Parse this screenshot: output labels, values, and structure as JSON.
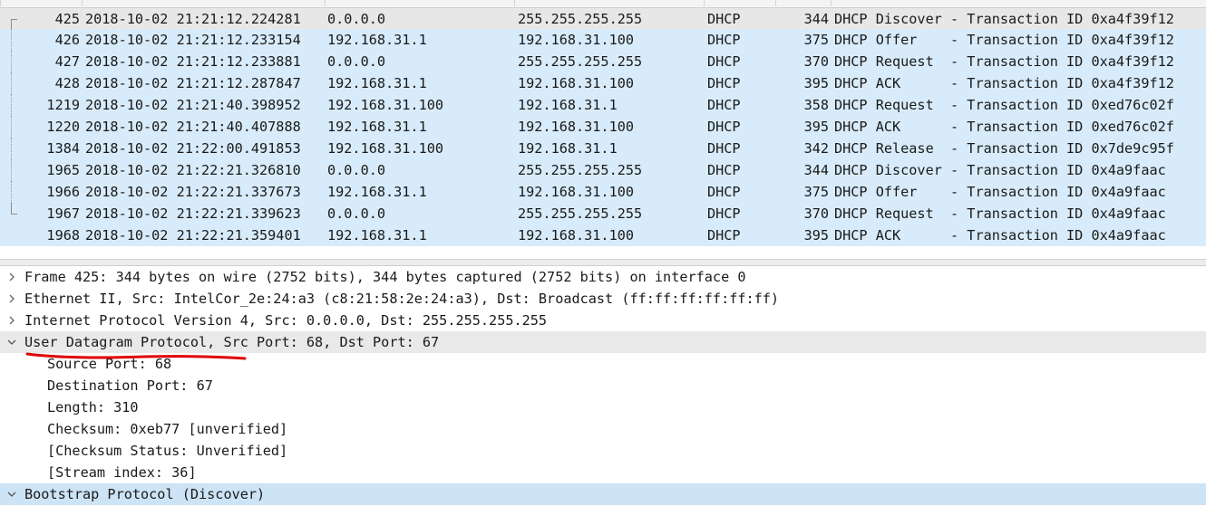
{
  "packet_list": {
    "rows": [
      {
        "no": "425",
        "time": "2018-10-02 21:21:12.224281",
        "src": "0.0.0.0",
        "dst": "255.255.255.255",
        "proto": "DHCP",
        "len": "344",
        "info": "DHCP Discover - Transaction ID 0xa4f39f12"
      },
      {
        "no": "426",
        "time": "2018-10-02 21:21:12.233154",
        "src": "192.168.31.1",
        "dst": "192.168.31.100",
        "proto": "DHCP",
        "len": "375",
        "info": "DHCP Offer    - Transaction ID 0xa4f39f12"
      },
      {
        "no": "427",
        "time": "2018-10-02 21:21:12.233881",
        "src": "0.0.0.0",
        "dst": "255.255.255.255",
        "proto": "DHCP",
        "len": "370",
        "info": "DHCP Request  - Transaction ID 0xa4f39f12"
      },
      {
        "no": "428",
        "time": "2018-10-02 21:21:12.287847",
        "src": "192.168.31.1",
        "dst": "192.168.31.100",
        "proto": "DHCP",
        "len": "395",
        "info": "DHCP ACK      - Transaction ID 0xa4f39f12"
      },
      {
        "no": "1219",
        "time": "2018-10-02 21:21:40.398952",
        "src": "192.168.31.100",
        "dst": "192.168.31.1",
        "proto": "DHCP",
        "len": "358",
        "info": "DHCP Request  - Transaction ID 0xed76c02f"
      },
      {
        "no": "1220",
        "time": "2018-10-02 21:21:40.407888",
        "src": "192.168.31.1",
        "dst": "192.168.31.100",
        "proto": "DHCP",
        "len": "395",
        "info": "DHCP ACK      - Transaction ID 0xed76c02f"
      },
      {
        "no": "1384",
        "time": "2018-10-02 21:22:00.491853",
        "src": "192.168.31.100",
        "dst": "192.168.31.1",
        "proto": "DHCP",
        "len": "342",
        "info": "DHCP Release  - Transaction ID 0x7de9c95f"
      },
      {
        "no": "1965",
        "time": "2018-10-02 21:22:21.326810",
        "src": "0.0.0.0",
        "dst": "255.255.255.255",
        "proto": "DHCP",
        "len": "344",
        "info": "DHCP Discover - Transaction ID 0x4a9faac"
      },
      {
        "no": "1966",
        "time": "2018-10-02 21:22:21.337673",
        "src": "192.168.31.1",
        "dst": "192.168.31.100",
        "proto": "DHCP",
        "len": "375",
        "info": "DHCP Offer    - Transaction ID 0x4a9faac"
      },
      {
        "no": "1967",
        "time": "2018-10-02 21:22:21.339623",
        "src": "0.0.0.0",
        "dst": "255.255.255.255",
        "proto": "DHCP",
        "len": "370",
        "info": "DHCP Request  - Transaction ID 0x4a9faac"
      },
      {
        "no": "1968",
        "time": "2018-10-02 21:22:21.359401",
        "src": "192.168.31.1",
        "dst": "192.168.31.100",
        "proto": "DHCP",
        "len": "395",
        "info": "DHCP ACK      - Transaction ID 0x4a9faac"
      }
    ]
  },
  "details": {
    "items": [
      {
        "text": "Frame 425: 344 bytes on wire (2752 bits), 344 bytes captured (2752 bits) on interface 0",
        "level": 0,
        "expander": "collapsed"
      },
      {
        "text": "Ethernet II, Src: IntelCor_2e:24:a3 (c8:21:58:2e:24:a3), Dst: Broadcast (ff:ff:ff:ff:ff:ff)",
        "level": 0,
        "expander": "collapsed"
      },
      {
        "text": "Internet Protocol Version 4, Src: 0.0.0.0, Dst: 255.255.255.255",
        "level": 0,
        "expander": "collapsed"
      },
      {
        "text": "User Datagram Protocol, Src Port: 68, Dst Port: 67",
        "level": 0,
        "expander": "expanded"
      },
      {
        "text": "Source Port: 68",
        "level": 1,
        "expander": "none"
      },
      {
        "text": "Destination Port: 67",
        "level": 1,
        "expander": "none"
      },
      {
        "text": "Length: 310",
        "level": 1,
        "expander": "none"
      },
      {
        "text": "Checksum: 0xeb77 [unverified]",
        "level": 1,
        "expander": "none"
      },
      {
        "text": "[Checksum Status: Unverified]",
        "level": 1,
        "expander": "none"
      },
      {
        "text": "[Stream index: 36]",
        "level": 1,
        "expander": "none"
      },
      {
        "text": "Bootstrap Protocol (Discover)",
        "level": 0,
        "expander": "expanded"
      }
    ]
  },
  "colors": {
    "row_dhcp": "#d8ebfa",
    "row_current": "#e7e7e7",
    "detail_selected": "#cde3f6",
    "annotation_red": "#e00000"
  }
}
